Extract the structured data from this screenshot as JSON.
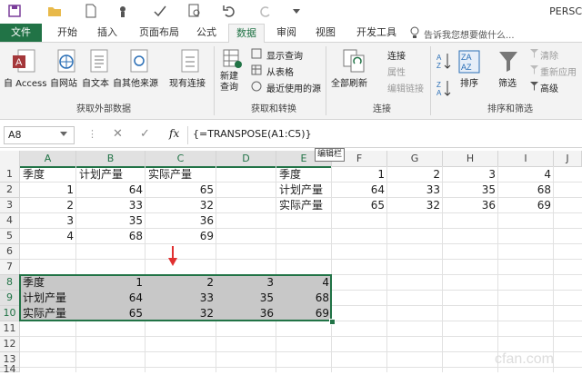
{
  "app": {
    "title_partial": "PERSC"
  },
  "tabs": [
    "文件",
    "开始",
    "插入",
    "页面布局",
    "公式",
    "数据",
    "审阅",
    "视图",
    "开发工具"
  ],
  "tell_me": "告诉我您想要做什么...",
  "ribbon": {
    "get_external": {
      "items": [
        "自 Access",
        "自网站",
        "自文本",
        "自其他来源",
        "现有连接"
      ],
      "group": "获取外部数据"
    },
    "get_transform": {
      "new_query": "新建\n查询",
      "items": [
        "显示查询",
        "从表格",
        "最近使用的源"
      ],
      "group": "获取和转换"
    },
    "connections": {
      "refresh_all": "全部刷新",
      "items": [
        "连接",
        "属性",
        "编辑链接"
      ],
      "group": "连接"
    },
    "sort_filter": {
      "sort": "排序",
      "filter": "筛选",
      "items": [
        "清除",
        "重新应用",
        "高级"
      ],
      "group": "排序和筛选"
    }
  },
  "formula_bar": {
    "name_box": "A8",
    "fx": "fx",
    "formula": "{=TRANSPOSE(A1:C5)}",
    "tooltip": "编辑栏"
  },
  "grid": {
    "columns": [
      "A",
      "B",
      "C",
      "D",
      "E",
      "F",
      "G",
      "H",
      "I",
      "J"
    ],
    "rows": [
      "1",
      "2",
      "3",
      "4",
      "5",
      "6",
      "7",
      "8",
      "9",
      "10",
      "11",
      "12",
      "13",
      "14"
    ],
    "cells": [
      {
        "r": 1,
        "c": "A",
        "v": "季度"
      },
      {
        "r": 1,
        "c": "B",
        "v": "计划产量"
      },
      {
        "r": 1,
        "c": "C",
        "v": "实际产量"
      },
      {
        "r": 2,
        "c": "A",
        "v": "1",
        "n": true
      },
      {
        "r": 2,
        "c": "B",
        "v": "64",
        "n": true
      },
      {
        "r": 2,
        "c": "C",
        "v": "65",
        "n": true
      },
      {
        "r": 3,
        "c": "A",
        "v": "2",
        "n": true
      },
      {
        "r": 3,
        "c": "B",
        "v": "33",
        "n": true
      },
      {
        "r": 3,
        "c": "C",
        "v": "32",
        "n": true
      },
      {
        "r": 4,
        "c": "A",
        "v": "3",
        "n": true
      },
      {
        "r": 4,
        "c": "B",
        "v": "35",
        "n": true
      },
      {
        "r": 4,
        "c": "C",
        "v": "36",
        "n": true
      },
      {
        "r": 5,
        "c": "A",
        "v": "4",
        "n": true
      },
      {
        "r": 5,
        "c": "B",
        "v": "68",
        "n": true
      },
      {
        "r": 5,
        "c": "C",
        "v": "69",
        "n": true
      },
      {
        "r": 1,
        "c": "E",
        "v": "季度"
      },
      {
        "r": 1,
        "c": "F",
        "v": "1",
        "n": true
      },
      {
        "r": 1,
        "c": "G",
        "v": "2",
        "n": true
      },
      {
        "r": 1,
        "c": "H",
        "v": "3",
        "n": true
      },
      {
        "r": 1,
        "c": "I",
        "v": "4",
        "n": true
      },
      {
        "r": 2,
        "c": "E",
        "v": "计划产量"
      },
      {
        "r": 2,
        "c": "F",
        "v": "64",
        "n": true
      },
      {
        "r": 2,
        "c": "G",
        "v": "33",
        "n": true
      },
      {
        "r": 2,
        "c": "H",
        "v": "35",
        "n": true
      },
      {
        "r": 2,
        "c": "I",
        "v": "68",
        "n": true
      },
      {
        "r": 3,
        "c": "E",
        "v": "实际产量"
      },
      {
        "r": 3,
        "c": "F",
        "v": "65",
        "n": true
      },
      {
        "r": 3,
        "c": "G",
        "v": "32",
        "n": true
      },
      {
        "r": 3,
        "c": "H",
        "v": "36",
        "n": true
      },
      {
        "r": 3,
        "c": "I",
        "v": "69",
        "n": true
      },
      {
        "r": 8,
        "c": "A",
        "v": "季度"
      },
      {
        "r": 8,
        "c": "B",
        "v": "1",
        "n": true
      },
      {
        "r": 8,
        "c": "C",
        "v": "2",
        "n": true
      },
      {
        "r": 8,
        "c": "D",
        "v": "3",
        "n": true
      },
      {
        "r": 8,
        "c": "E",
        "v": "4",
        "n": true
      },
      {
        "r": 9,
        "c": "A",
        "v": "计划产量"
      },
      {
        "r": 9,
        "c": "B",
        "v": "64",
        "n": true
      },
      {
        "r": 9,
        "c": "C",
        "v": "33",
        "n": true
      },
      {
        "r": 9,
        "c": "D",
        "v": "35",
        "n": true
      },
      {
        "r": 9,
        "c": "E",
        "v": "68",
        "n": true
      },
      {
        "r": 10,
        "c": "A",
        "v": "实际产量"
      },
      {
        "r": 10,
        "c": "B",
        "v": "65",
        "n": true
      },
      {
        "r": 10,
        "c": "C",
        "v": "32",
        "n": true
      },
      {
        "r": 10,
        "c": "D",
        "v": "36",
        "n": true
      },
      {
        "r": 10,
        "c": "E",
        "v": "69",
        "n": true
      }
    ]
  },
  "colors": {
    "accent": "#217346",
    "selection": "#c8c8c8",
    "arrow": "#e03030"
  }
}
